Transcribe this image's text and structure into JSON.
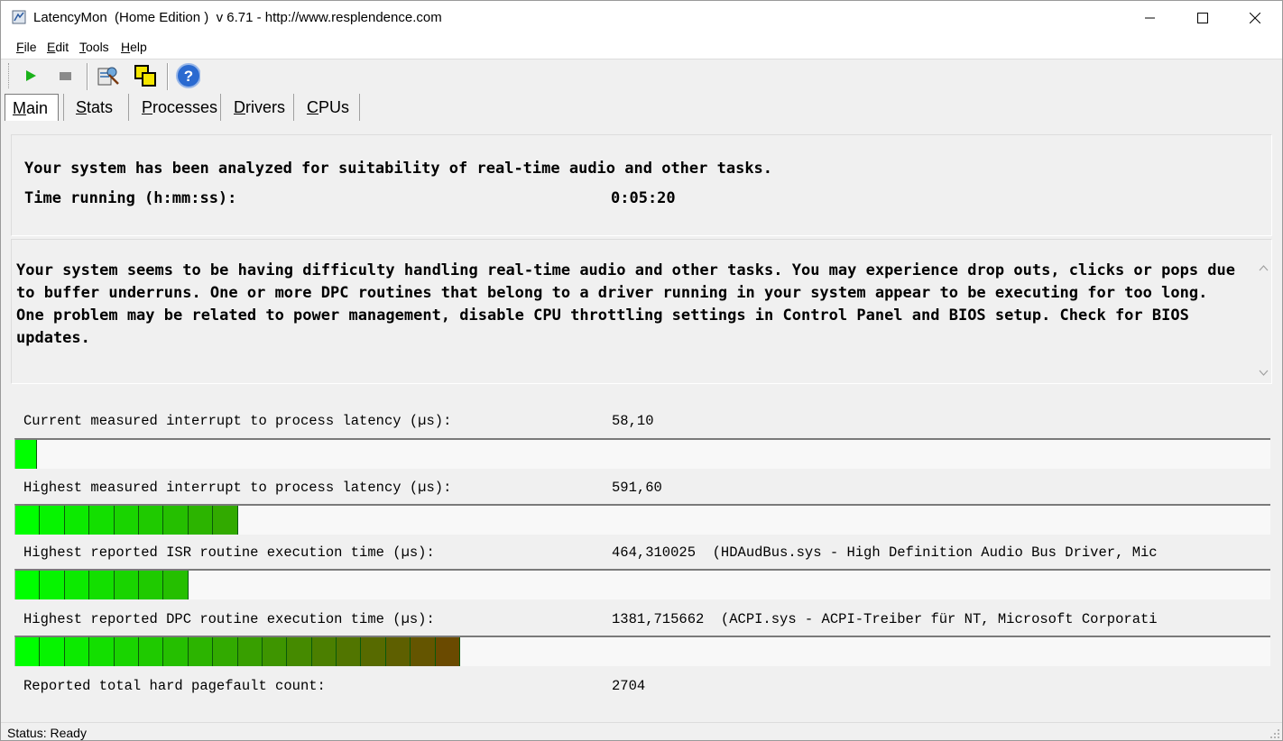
{
  "window": {
    "title": "LatencyMon  (Home Edition )  v 6.71 - http://www.resplendence.com"
  },
  "menu": {
    "items": [
      {
        "accel": "F",
        "rest": "ile"
      },
      {
        "accel": "E",
        "rest": "dit"
      },
      {
        "accel": "T",
        "rest": "ools"
      },
      {
        "accel": "H",
        "rest": "elp"
      }
    ]
  },
  "toolbar": {
    "icons": [
      "play-icon",
      "stop-icon",
      "report-icon",
      "cpu-icon",
      "help-icon"
    ]
  },
  "tabs": [
    {
      "accel": "M",
      "rest": "ain",
      "active": true
    },
    {
      "accel": "S",
      "rest": "tats",
      "active": false
    },
    {
      "accel": "P",
      "rest": "rocesses",
      "active": false
    },
    {
      "accel": "D",
      "rest": "rivers",
      "active": false
    },
    {
      "accel": "C",
      "rest": "PUs",
      "active": false
    }
  ],
  "summary": {
    "analyzed": "Your system has been analyzed for suitability of real-time audio and other tasks.",
    "time_label": "Time running (h:mm:ss):",
    "time_value": "0:05:20"
  },
  "conclusion": {
    "text": "Your system seems to be having difficulty handling real-time audio and other tasks. You may experience drop outs, clicks or pops due to buffer underruns. One or more DPC routines that belong to a driver running in your system appear to be executing for too long. One problem may be related to power management, disable CPU throttling settings in Control Panel and BIOS setup. Check for BIOS updates."
  },
  "metrics": [
    {
      "label": "Current measured interrupt to process latency (µs):",
      "value": "58,10",
      "segments": 1
    },
    {
      "label": "Highest measured interrupt to process latency (µs):",
      "value": "591,60",
      "segments": 9
    },
    {
      "label": "Highest reported ISR routine execution time (µs):",
      "value": "464,310025  (HDAudBus.sys - High Definition Audio Bus Driver, Mic",
      "segments": 7
    },
    {
      "label": "Highest reported DPC routine execution time (µs):",
      "value": "1381,715662  (ACPI.sys - ACPI-Treiber für NT, Microsoft Corporati",
      "segments": 18
    }
  ],
  "pagefault": {
    "label": "Reported total hard pagefault count:",
    "value": "2704"
  },
  "status": {
    "text": "Status: Ready"
  },
  "colors": {
    "bar_start": "#00ff00",
    "bar_end": "#6a4a00"
  }
}
